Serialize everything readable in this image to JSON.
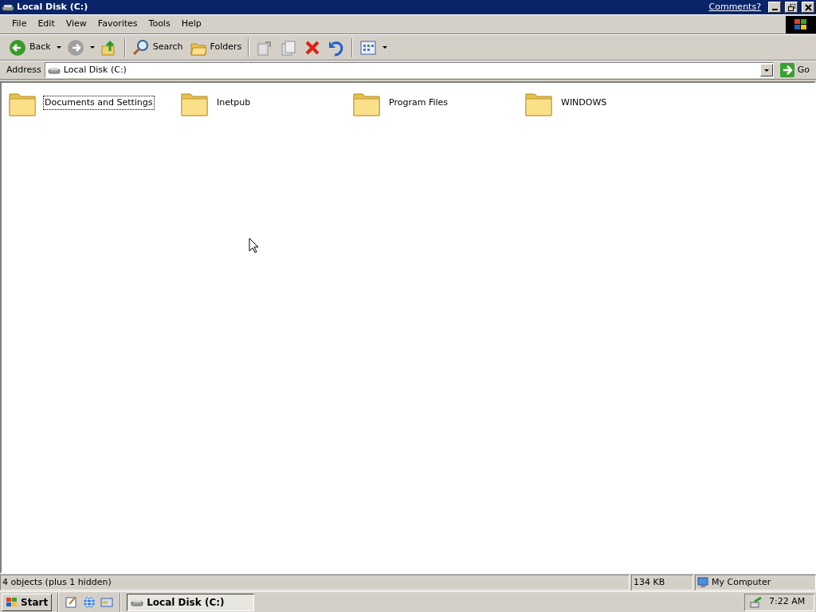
{
  "window": {
    "title": "Local Disk (C:)",
    "comments_link": "Comments?"
  },
  "menu": [
    "File",
    "Edit",
    "View",
    "Favorites",
    "Tools",
    "Help"
  ],
  "toolbar": [
    {
      "kind": "back",
      "label": "Back",
      "dropdown": true
    },
    {
      "kind": "forward",
      "dropdown": true
    },
    {
      "kind": "up"
    },
    {
      "kind": "separator"
    },
    {
      "kind": "search",
      "label": "Search"
    },
    {
      "kind": "folders",
      "label": "Folders"
    },
    {
      "kind": "separator"
    },
    {
      "kind": "move"
    },
    {
      "kind": "copy"
    },
    {
      "kind": "delete"
    },
    {
      "kind": "undo"
    },
    {
      "kind": "separator"
    },
    {
      "kind": "views",
      "dropdown": true
    }
  ],
  "address": {
    "label": "Address",
    "value": "Local Disk (C:)",
    "go": "Go"
  },
  "items": [
    {
      "name": "Documents and Settings",
      "focused": true
    },
    {
      "name": "Inetpub",
      "focused": false
    },
    {
      "name": "Program Files",
      "focused": false
    },
    {
      "name": "WINDOWS",
      "focused": false
    }
  ],
  "status_bar": {
    "text": "4 objects (plus 1 hidden)",
    "size": "134 KB",
    "zone": "My Computer"
  },
  "taskbar": {
    "start": "Start",
    "quick_launch": [
      {
        "kind": "notepad"
      },
      {
        "kind": "browser"
      },
      {
        "kind": "desktop"
      }
    ],
    "tasks": [
      {
        "label": "Local Disk (C:)",
        "active": true
      }
    ],
    "clock": "7:22 AM"
  }
}
